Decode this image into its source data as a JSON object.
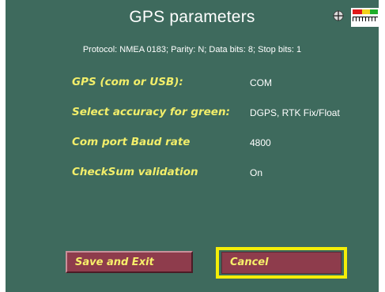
{
  "header": {
    "title": "GPS parameters",
    "protocol_line": "Protocol: NMEA 0183; Parity: N; Data bits: 8; Stop bits: 1"
  },
  "status_icons": {
    "crosshair_icon": "crosshair-icon",
    "signal_meter_icon": "signal-meter-icon",
    "meter_colors": [
      "#e01818",
      "#f2d21c",
      "#1fae2a"
    ]
  },
  "parameters": [
    {
      "label": "GPS (com or USB):",
      "value": "COM"
    },
    {
      "label": "Select accuracy for green:",
      "value": "DGPS, RTK Fix/Float"
    },
    {
      "label": "Com port Baud rate",
      "value": "4800"
    },
    {
      "label": "CheckSum validation",
      "value": "On"
    }
  ],
  "buttons": {
    "save_label": "Save and Exit",
    "cancel_label": "Cancel"
  },
  "colors": {
    "background": "#3e6a5d",
    "label_yellow": "#f2ee6a",
    "button_fill": "#8e3c4c",
    "focus_highlight": "#f4ee08"
  }
}
